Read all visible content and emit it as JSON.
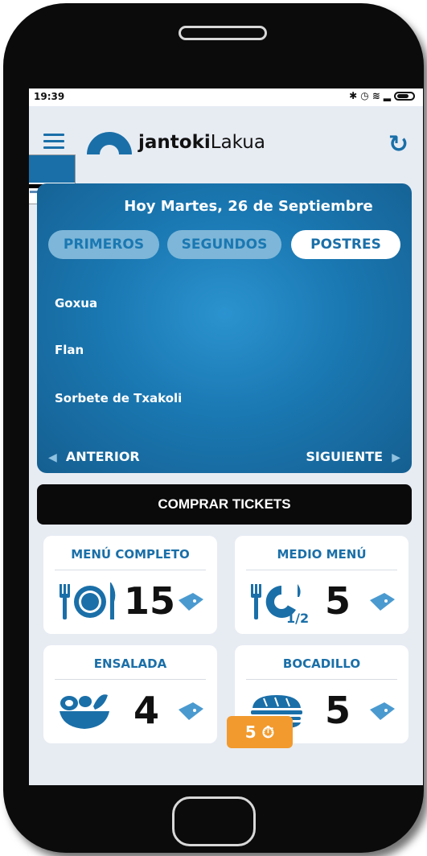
{
  "status_bar": {
    "time": "19:39",
    "icons": [
      "bluetooth-icon",
      "alarm-icon",
      "wifi-icon",
      "signal-icon",
      "battery-icon"
    ]
  },
  "header": {
    "logo_bold": "jantoki",
    "logo_light": "Lakua",
    "menu_icon": "hamburger-icon",
    "refresh_icon": "refresh-icon"
  },
  "menu": {
    "date": "Hoy Martes, 26 de Septiembre",
    "tabs": [
      {
        "label": "PRIMEROS",
        "active": false
      },
      {
        "label": "SEGUNDOS",
        "active": false
      },
      {
        "label": "POSTRES",
        "active": true
      }
    ],
    "dishes": [
      "Goxua",
      "Flan",
      "Sorbete de Txakoli"
    ],
    "prev_label": "ANTERIOR",
    "next_label": "SIGUIENTE"
  },
  "buy": {
    "label": "COMPRAR TICKETS"
  },
  "tickets": [
    {
      "title": "MENÚ COMPLETO",
      "count": "15",
      "icon": "plate-cutlery-icon"
    },
    {
      "title": "MEDIO MENÚ",
      "count": "5",
      "icon": "half-plate-icon",
      "icon_label": "1/2"
    },
    {
      "title": "ENSALADA",
      "count": "4",
      "icon": "salad-bowl-icon"
    },
    {
      "title": "BOCADILLO",
      "count": "5",
      "icon": "sandwich-icon"
    }
  ],
  "timer": {
    "value": "5",
    "icon": "stopwatch-icon"
  },
  "colors": {
    "primary": "#1a6fa8",
    "accent": "#f29a2e",
    "background": "#e7ecf3"
  }
}
